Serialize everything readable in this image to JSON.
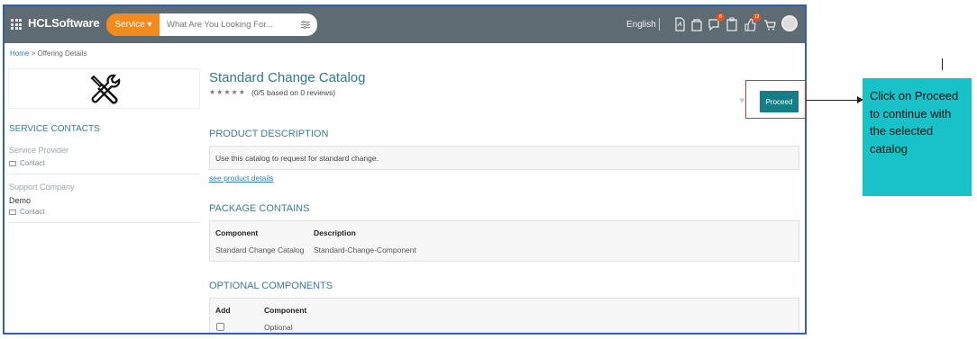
{
  "topbar": {
    "brand": "HCLSoftware",
    "service_label": "Service ▾",
    "search_placeholder": "What Are You Looking For...",
    "language": "English",
    "icons": [
      "grid-icon",
      "filter-icon",
      "document-icon",
      "cart-bag-icon",
      "chat-icon",
      "clipboard-icon",
      "thumbs-up-icon",
      "cart-icon",
      "avatar"
    ],
    "badges": {
      "chat": "8",
      "thumbs_up": "12"
    },
    "colors": {
      "bar": "#5f6b72",
      "service": "#f28a1d",
      "badge": "#e8561e"
    }
  },
  "breadcrumb": {
    "home": "Home",
    "separator": ">",
    "current": "Offering Details"
  },
  "sidebar": {
    "logo_icon": "wrench-screwdriver-icon",
    "service_contacts_heading": "SERVICE CONTACTS",
    "service_provider_label": "Service Provider",
    "service_provider_contact": "Contact",
    "support_company_label": "Support Company",
    "support_company_value": "Demo",
    "support_company_contact": "Contact"
  },
  "offering": {
    "title": "Standard Change Catalog",
    "stars": "★★★★★",
    "rating": 0,
    "reviews_text": "(0/5 based on 0 reviews)",
    "proceed_label": "Proceed",
    "accent": "#157d85"
  },
  "product_description": {
    "heading": "PRODUCT DESCRIPTION",
    "text": "Use this catalog to request for standard change.",
    "link": "see product details"
  },
  "package_contains": {
    "heading": "PACKAGE CONTAINS",
    "columns": [
      "Component",
      "Description"
    ],
    "rows": [
      [
        "Standard Change Catalog",
        "Standard-Change-Component"
      ]
    ]
  },
  "optional_components": {
    "heading": "OPTIONAL COMPONENTS",
    "columns": [
      "Add",
      "Component"
    ],
    "rows": [
      [
        "",
        "Optional"
      ]
    ]
  },
  "annotation": {
    "note": "Click on Proceed to continue with the selected catalog",
    "note_color": "#17c2c8",
    "highlight_color": "#e03030"
  }
}
